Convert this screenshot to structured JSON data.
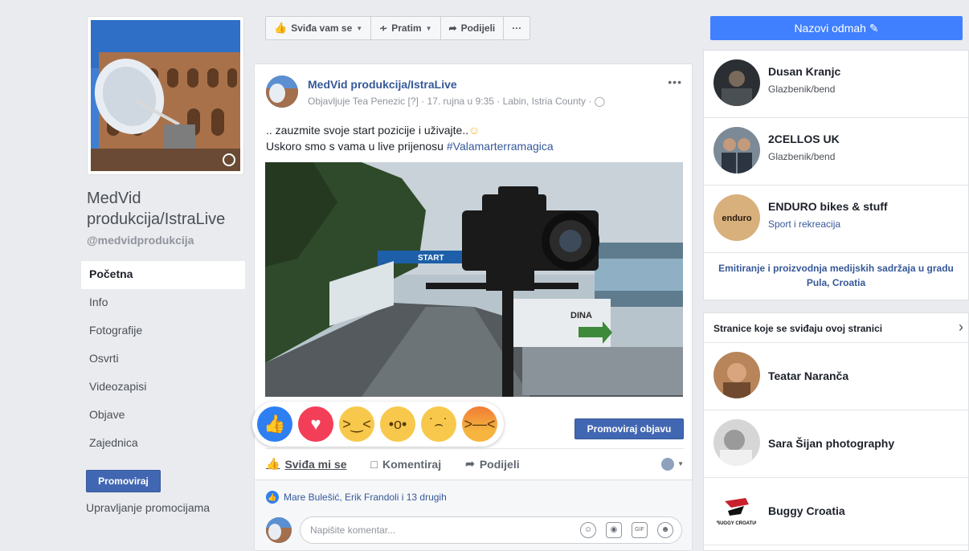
{
  "left": {
    "page_name": "MedVid produkcija/IstraLive",
    "handle": "@medvidprodukcija",
    "nav": [
      {
        "label": "Početna",
        "active": true
      },
      {
        "label": "Info"
      },
      {
        "label": "Fotografije"
      },
      {
        "label": "Osvrti"
      },
      {
        "label": "Videozapisi"
      },
      {
        "label": "Objave"
      },
      {
        "label": "Zajednica"
      }
    ],
    "promote_label": "Promoviraj",
    "manage_promotions": "Upravljanje promocijama"
  },
  "action_bar": {
    "like_label": "Sviđa vam se",
    "follow_label": "Pratim",
    "share_label": "Podijeli",
    "more_label": "···"
  },
  "post": {
    "author": "MedVid produkcija/IstraLive",
    "meta": "Objavljuje Tea Penezic [?] · 17. rujna u 9:35 · Labin, Istria County ·",
    "text_line1": ".. zauzmite svoje start pozicije i uživajte..",
    "text_line2_prefix": "Uskoro smo s vama u live prijenosu ",
    "hashtag": "#Valamarterramagica",
    "image_banner_start": "START",
    "image_sign": "DINA",
    "boost_label": "Promoviraj objavu",
    "actions": {
      "like": "Sviđa mi se",
      "comment": "Komentiraj",
      "share": "Podijeli"
    },
    "likers": "Mare Bulešić, Erik Frandoli i 13 drugih",
    "comment_placeholder": "Napišite komentar...",
    "comment_icons": [
      "smiley-icon",
      "camera-icon",
      "gif-icon",
      "sticker-icon"
    ],
    "gif_text": "GIF"
  },
  "reactions": [
    "like",
    "love",
    "haha",
    "wow",
    "sad",
    "angry"
  ],
  "right": {
    "call_button": "Nazovi odmah",
    "related": [
      {
        "name": "Dusan Kranjc",
        "category": "Glazbenik/bend"
      },
      {
        "name": "2CELLOS UK",
        "category": "Glazbenik/bend"
      },
      {
        "name": "ENDURO bikes & stuff",
        "category": "Sport i rekreacija",
        "avatar_text": "enduro"
      }
    ],
    "description": "Emitiranje i proizvodnja medijskih sadržaja u gradu Pula, Croatia",
    "liked_pages_header": "Stranice koje se sviđaju ovoj stranici",
    "liked_pages": [
      {
        "name": "Teatar Naranča"
      },
      {
        "name": "Sara Šijan photography"
      },
      {
        "name": "Buggy Croatia",
        "avatar_text": "BUGGY CROATIA"
      }
    ]
  },
  "colors": {
    "fb_blue": "#4267b2",
    "link_blue": "#365899",
    "call_blue": "#4080ff",
    "background": "#e9ebee"
  }
}
